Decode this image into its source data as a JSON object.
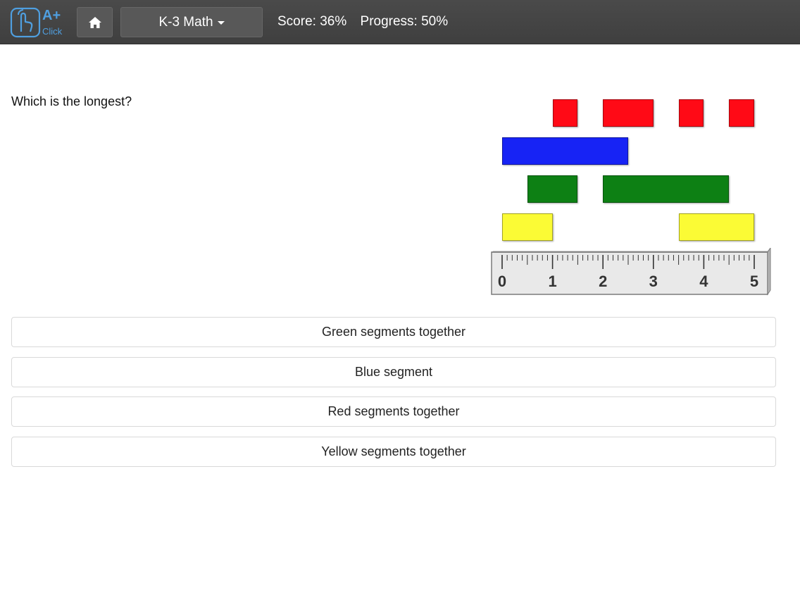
{
  "logo": {
    "text_top": "A+",
    "text_bottom": "Click"
  },
  "header": {
    "subject_label": "K-3 Math",
    "score_text": "Score: 36%",
    "progress_text": "Progress: 50%"
  },
  "question": {
    "text": "Which is the longest?"
  },
  "figure": {
    "colors": {
      "red": "#ff0a16",
      "blue": "#1723f5",
      "green": "#0d8014",
      "yellow": "#fbfb35"
    },
    "segments": [
      {
        "color": "red",
        "start": 1.0,
        "end": 1.5
      },
      {
        "color": "red",
        "start": 2.0,
        "end": 3.0
      },
      {
        "color": "red",
        "start": 3.5,
        "end": 4.0
      },
      {
        "color": "red",
        "start": 4.5,
        "end": 5.0
      },
      {
        "color": "blue",
        "start": 0.0,
        "end": 2.5
      },
      {
        "color": "green",
        "start": 0.5,
        "end": 1.5
      },
      {
        "color": "green",
        "start": 2.0,
        "end": 4.5
      },
      {
        "color": "yellow",
        "start": 0.0,
        "end": 1.0
      },
      {
        "color": "yellow",
        "start": 3.5,
        "end": 5.0
      }
    ],
    "ruler_labels": [
      "0",
      "1",
      "2",
      "3",
      "4",
      "5"
    ]
  },
  "answers": [
    {
      "label": "Green segments together"
    },
    {
      "label": "Blue segment"
    },
    {
      "label": "Red segments together"
    },
    {
      "label": "Yellow segments together"
    }
  ]
}
